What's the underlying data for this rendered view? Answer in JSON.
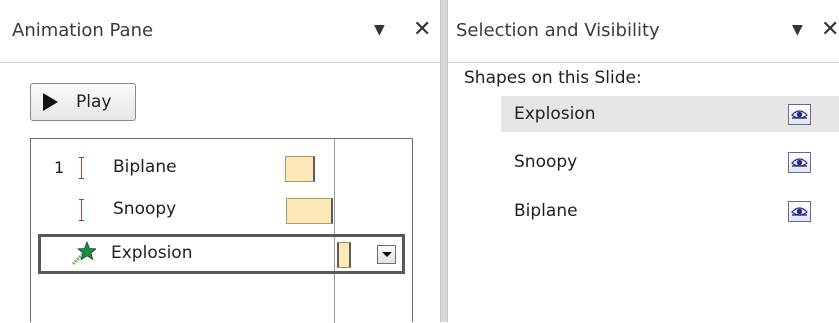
{
  "animation_pane": {
    "title": "Animation Pane",
    "play_label": "Play",
    "items": [
      {
        "number": "1",
        "label": "Biplane",
        "icon": "motion-path-icon"
      },
      {
        "number": "",
        "label": "Snoopy",
        "icon": "motion-path-icon"
      },
      {
        "number": "",
        "label": "Explosion",
        "icon": "star-effect-icon"
      }
    ]
  },
  "selection_pane": {
    "title": "Selection and Visibility",
    "shapes_label": "Shapes on this Slide:",
    "shapes": [
      {
        "name": "Explosion",
        "icon": "eye-icon"
      },
      {
        "name": "Snoopy",
        "icon": "eye-icon"
      },
      {
        "name": "Biplane",
        "icon": "eye-icon"
      }
    ]
  },
  "colors": {
    "timing_bar": "#fde9b8",
    "eye_pupil": "#2c2c88",
    "star_green": "#1e8a4a",
    "selection_border": "#595959"
  }
}
